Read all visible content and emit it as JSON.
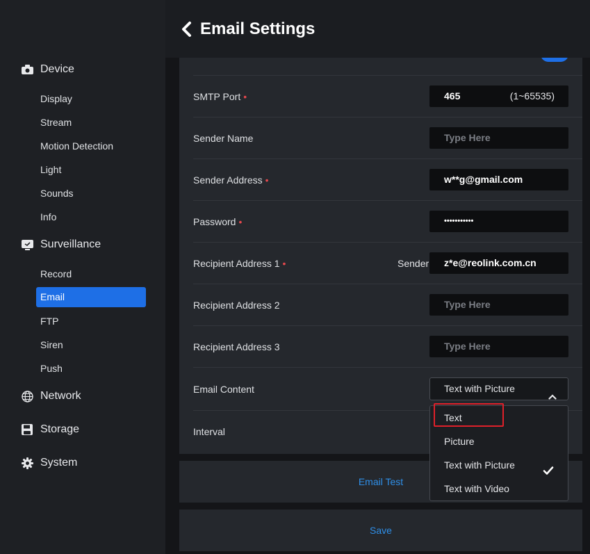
{
  "header": {
    "title": "Email Settings"
  },
  "sidebar": {
    "groups": [
      {
        "label": "Device",
        "icon": "camera-icon"
      },
      {
        "label": "Surveillance",
        "icon": "monitor-icon"
      },
      {
        "label": "Network",
        "icon": "globe-icon"
      },
      {
        "label": "Storage",
        "icon": "save-icon"
      },
      {
        "label": "System",
        "icon": "gear-icon"
      }
    ],
    "device_items": [
      "Display",
      "Stream",
      "Motion Detection",
      "Light",
      "Sounds",
      "Info"
    ],
    "surveillance_items": [
      "Record",
      "Email",
      "FTP",
      "Siren",
      "Push"
    ],
    "active_item": "Email"
  },
  "form": {
    "smtp_port": {
      "label": "SMTP Port",
      "required": "•",
      "value": "465",
      "range": "(1~65535)"
    },
    "sender_name": {
      "label": "Sender Name",
      "placeholder": "Type Here"
    },
    "sender_address": {
      "label": "Sender Address",
      "required": "•",
      "value": "w**g@gmail.com"
    },
    "password": {
      "label": "Password",
      "required": "•",
      "value": "•••••••••••"
    },
    "recipient_1": {
      "label": "Recipient Address 1",
      "required": "•",
      "tag": "Sender",
      "value": "z*e@reolink.com.cn"
    },
    "recipient_2": {
      "label": "Recipient Address 2",
      "placeholder": "Type Here"
    },
    "recipient_3": {
      "label": "Recipient Address 3",
      "placeholder": "Type Here"
    },
    "email_content": {
      "label": "Email Content",
      "value": "Text with Picture"
    },
    "interval": {
      "label": "Interval"
    }
  },
  "dropdown": {
    "options": [
      "Text",
      "Picture",
      "Text with Picture",
      "Text with Video"
    ],
    "selected": "Text with Picture",
    "highlighted": "Text"
  },
  "actions": {
    "email_test": "Email Test",
    "save": "Save"
  },
  "colors": {
    "accent": "#1e6fe6",
    "link": "#2f8fe8",
    "required": "#e5484d",
    "highlight_box": "#e0202a"
  }
}
